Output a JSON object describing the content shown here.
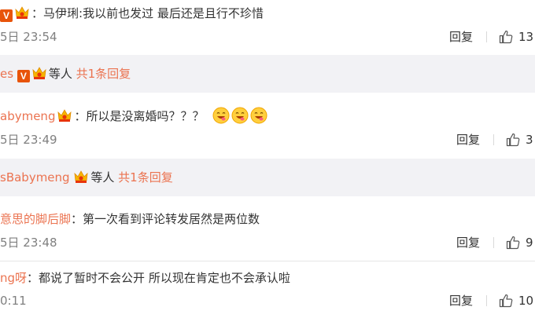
{
  "comments": [
    {
      "name": "",
      "sep": "：",
      "text": "马伊琍:我以前也发过 最后还是且行不珍惜",
      "time": "5日 23:54",
      "reply_label": "回复",
      "likes": "13"
    },
    {
      "name": "abymeng",
      "sep": "：",
      "text": "所以是没离婚吗？？？",
      "time": "5日 23:49",
      "reply_label": "回复",
      "likes": "3"
    },
    {
      "name": "意思的脚后脚",
      "sep": "：",
      "text": "第一次看到评论转发居然是两位数",
      "time": "5日 23:48",
      "reply_label": "回复",
      "likes": "9"
    },
    {
      "name": "ng呀",
      "sep": "：",
      "text": "都说了暂时不会公开 所以现在肯定也不会承认啦",
      "time": "0:11",
      "reply_label": "回复",
      "likes": "10"
    }
  ],
  "subreplies": [
    {
      "name": "es",
      "suffix": "等人",
      "link": "共1条回复"
    },
    {
      "name": "sBabymeng",
      "suffix": "等人",
      "link": "共1条回复"
    }
  ],
  "badges": {
    "v_label": "V"
  },
  "colors": {
    "name": "#eb7350",
    "subbar_bg": "#f2f2f5",
    "time": "#808080"
  },
  "icons": [
    "v-badge",
    "crown-icon",
    "thumbs-up-icon",
    "yummy-face-emoji"
  ]
}
